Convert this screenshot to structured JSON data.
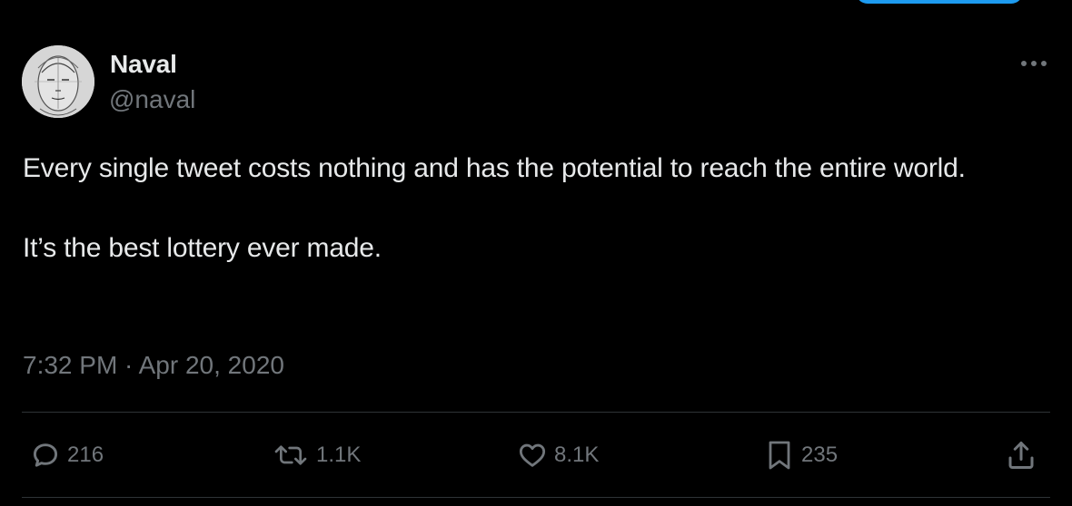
{
  "tweet": {
    "author": {
      "name": "Naval",
      "handle": "@naval"
    },
    "text": {
      "line1": "Every single tweet costs nothing and has the potential to reach the entire world.",
      "line2": "It’s the best lottery ever made."
    },
    "timestamp": {
      "time": "7:32 PM",
      "separator": " · ",
      "date": "Apr 20, 2020"
    },
    "actions": {
      "replies": "216",
      "retweets": "1.1K",
      "likes": "8.1K",
      "bookmarks": "235"
    }
  },
  "icons": {
    "more": "more-horizontal-icon",
    "reply": "speech-bubble-icon",
    "retweet": "retweet-arrows-icon",
    "like": "heart-icon",
    "bookmark": "bookmark-icon",
    "share": "share-upload-icon"
  },
  "colors": {
    "background": "#000000",
    "primary_text": "#e7e9ea",
    "secondary_text": "#71767b",
    "divider": "#2f3336",
    "accent": "#1d9bf0"
  }
}
